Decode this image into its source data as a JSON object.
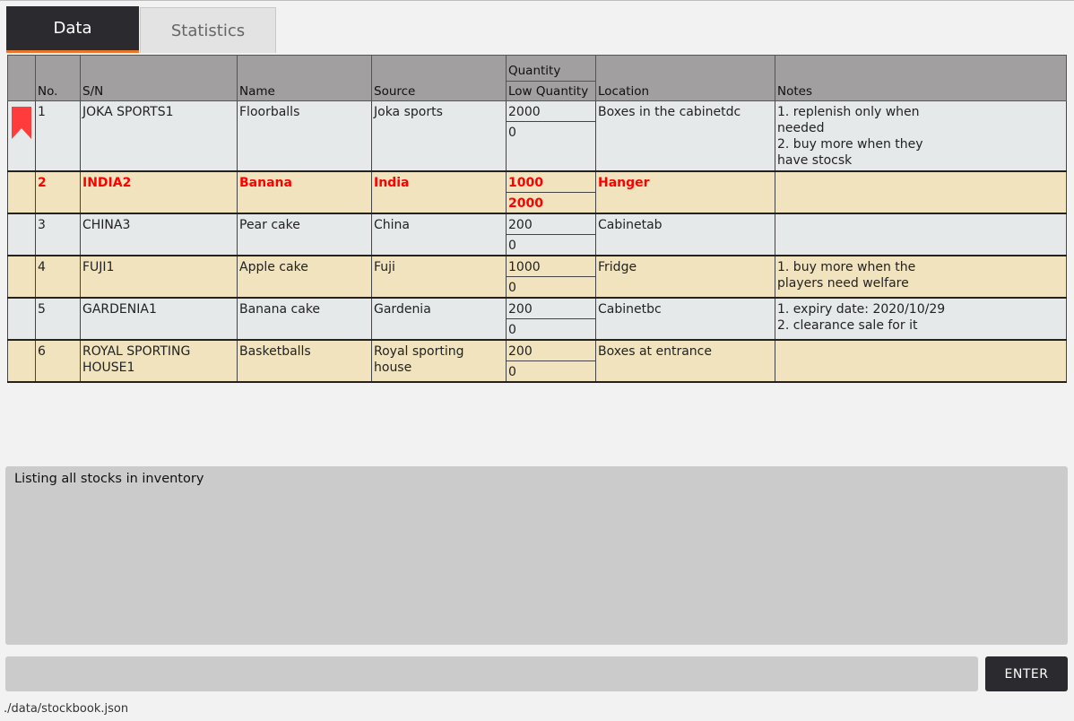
{
  "tabs": [
    {
      "label": "Data",
      "active": true
    },
    {
      "label": "Statistics",
      "active": false
    }
  ],
  "table": {
    "headers": {
      "marker": "",
      "no": "No.",
      "sn": "S/N",
      "name": "Name",
      "source": "Source",
      "quantity": "Quantity",
      "low_quantity": "Low Quantity",
      "location": "Location",
      "notes": "Notes"
    },
    "rows": [
      {
        "no": "1",
        "sn": "JOKA SPORTS1",
        "name": "Floorballs",
        "source": "Joka sports",
        "quantity": "2000",
        "low_quantity": "0",
        "location": "Boxes in the cabinetdc",
        "notes": [
          "1. replenish only when",
          "needed",
          "2. buy more when they",
          "have stocsk"
        ],
        "flagged": true,
        "selected": false,
        "shade": "gray"
      },
      {
        "no": "2",
        "sn": "INDIA2",
        "name": "Banana",
        "source": "India",
        "quantity": "1000",
        "low_quantity": "2000",
        "location": "Hanger",
        "notes": [],
        "flagged": false,
        "selected": true,
        "shade": "tan"
      },
      {
        "no": "3",
        "sn": "CHINA3",
        "name": "Pear cake",
        "source": "China",
        "quantity": "200",
        "low_quantity": "0",
        "location": "Cabinetab",
        "notes": [],
        "flagged": false,
        "selected": false,
        "shade": "gray"
      },
      {
        "no": "4",
        "sn": "FUJI1",
        "name": "Apple cake",
        "source": "Fuji",
        "quantity": "1000",
        "low_quantity": "0",
        "location": "Fridge",
        "notes": [
          "1. buy more when the",
          "players need welfare"
        ],
        "flagged": false,
        "selected": false,
        "shade": "tan"
      },
      {
        "no": "5",
        "sn": "GARDENIA1",
        "name": "Banana cake",
        "source": "Gardenia",
        "quantity": "200",
        "low_quantity": "0",
        "location": "Cabinetbc",
        "notes": [
          "1. expiry date: 2020/10/29",
          "2. clearance sale for it"
        ],
        "flagged": false,
        "selected": false,
        "shade": "gray"
      },
      {
        "no": "6",
        "sn": "ROYAL SPORTING HOUSE1",
        "name": "Basketballs",
        "source": "Royal sporting house",
        "quantity": "200",
        "low_quantity": "0",
        "location": "Boxes at entrance",
        "notes": [],
        "flagged": false,
        "selected": false,
        "shade": "tan"
      }
    ]
  },
  "result_display": {
    "text": "Listing all stocks in inventory"
  },
  "command_box": {
    "value": "",
    "placeholder": "",
    "enter_label": "ENTER"
  },
  "status_bar": {
    "path": "./data/stockbook.json"
  },
  "colors": {
    "flag": "#ff3b3b",
    "selected_text": "#ff0000",
    "row_gray": "#e5e9ea",
    "row_tan": "#f0e3bd",
    "tab_accent": "#e8772e"
  },
  "icons": {
    "flag": "bookmark-flag-icon"
  }
}
